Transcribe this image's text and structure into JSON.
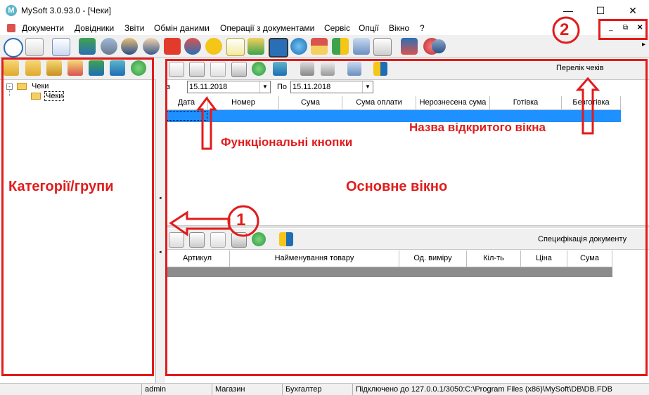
{
  "window": {
    "title": "MySoft 3.0.93.0 - [Чеки]",
    "logo_letter": "M",
    "controls": {
      "minimize": "—",
      "maximize": "☐",
      "close": "✕"
    },
    "mdi_controls": {
      "minimize": "_",
      "restore": "⧉",
      "close": "✕"
    }
  },
  "menu": [
    "Документи",
    "Довідники",
    "Звіти",
    "Обмін даними",
    "Операції з документами",
    "Сервіс",
    "Опції",
    "Вікно",
    "?"
  ],
  "toolbar": {
    "icons": [
      "clock-icon",
      "report-icon",
      "checklist-icon",
      "cubes-icon",
      "users-icon",
      "worker-icon",
      "person-icon",
      "puzzle-icon",
      "gear-icon",
      "smiley-icon",
      "note-icon",
      "transfer-icon",
      "monitor-icon",
      "globe-icon",
      "house-icon",
      "blocks-icon",
      "book-icon",
      "clipboard-icon",
      "keys-icon",
      "stamp-icon",
      "user-icon"
    ],
    "overflow": "▸"
  },
  "left_pane": {
    "toolbar_icons": [
      "folder-add-icon",
      "folder-add-sub-icon",
      "folder-edit-icon",
      "folder-delete-icon",
      "filter-icon",
      "filter-apply-icon",
      "refresh-icon"
    ],
    "tree": {
      "root": "Чеки",
      "child": "Чеки"
    }
  },
  "main": {
    "window_label": "Перелік чеків",
    "filter": {
      "from_label": "з",
      "from_date": "15.11.2018",
      "to_label": "По",
      "to_date": "15.11.2018"
    },
    "columns": [
      "Дата",
      "Номер",
      "Сума",
      "Сума оплати",
      "Нерознесена сума",
      "Готівка",
      "Безготівка"
    ]
  },
  "spec": {
    "window_label": "Специфікація документу",
    "columns": [
      "Артикул",
      "Найменування товару",
      "Од. виміру",
      "Кіл-ть",
      "Ціна",
      "Сума"
    ]
  },
  "statusbar": [
    "",
    "admin",
    "Магазин",
    "Бухгалтер",
    "Підключено до 127.0.0.1/3050:C:\\Program Files (x86)\\MySoft\\DB\\DB.FDB"
  ],
  "annotations": {
    "categories": "Категорії/групи",
    "main_window": "Основне вікно",
    "function_buttons": "Функціональні кнопки",
    "window_name": "Назва відкритого вікна",
    "marker1": "1",
    "marker2": "2"
  },
  "colors": {
    "annotation": "#e21b1b",
    "selection": "#1e90ff",
    "spec_row": "#8c8c8c"
  }
}
